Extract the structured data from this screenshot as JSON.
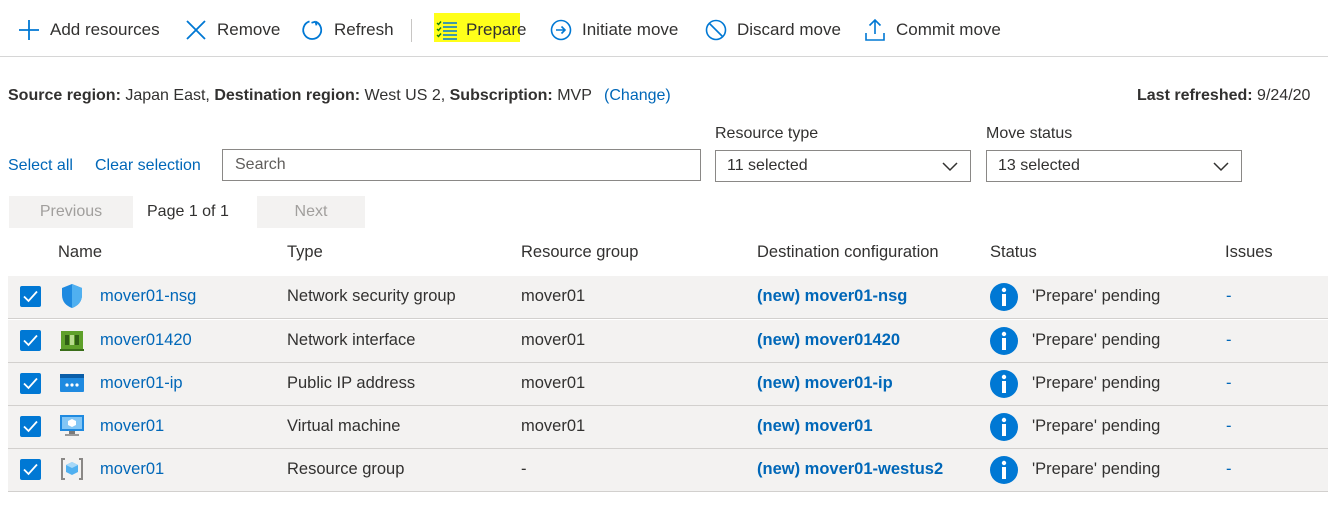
{
  "toolbar": {
    "add_resources": "Add resources",
    "remove": "Remove",
    "refresh": "Refresh",
    "prepare": "Prepare",
    "initiate_move": "Initiate move",
    "discard_move": "Discard move",
    "commit_move": "Commit move"
  },
  "summary": {
    "source_region_label": "Source region:",
    "source_region": "Japan East,",
    "destination_region_label": "Destination region:",
    "destination_region": "West US 2,",
    "subscription_label": "Subscription:",
    "subscription": "MVP",
    "change_link": "(Change)",
    "last_refreshed_label": "Last refreshed:",
    "last_refreshed": "9/24/20"
  },
  "filters": {
    "select_all": "Select all",
    "clear_selection": "Clear selection",
    "search_placeholder": "Search",
    "resource_type_label": "Resource type",
    "resource_type_value": "11 selected",
    "move_status_label": "Move status",
    "move_status_value": "13 selected"
  },
  "pager": {
    "previous": "Previous",
    "page_text": "Page 1 of 1",
    "next": "Next"
  },
  "table": {
    "headers": {
      "name": "Name",
      "type": "Type",
      "resource_group": "Resource group",
      "destination_configuration": "Destination configuration",
      "status": "Status",
      "issues": "Issues"
    },
    "rows": [
      {
        "name": "mover01-nsg",
        "icon": "network-security-group-icon",
        "type": "Network security group",
        "resource_group": "mover01",
        "destination": "(new) mover01-nsg",
        "status": "'Prepare' pending",
        "issues": "-"
      },
      {
        "name": "mover01420",
        "icon": "network-interface-icon",
        "type": "Network interface",
        "resource_group": "mover01",
        "destination": "(new) mover01420",
        "status": "'Prepare' pending",
        "issues": "-"
      },
      {
        "name": "mover01-ip",
        "icon": "public-ip-address-icon",
        "type": "Public IP address",
        "resource_group": "mover01",
        "destination": "(new) mover01-ip",
        "status": "'Prepare' pending",
        "issues": "-"
      },
      {
        "name": "mover01",
        "icon": "virtual-machine-icon",
        "type": "Virtual machine",
        "resource_group": "mover01",
        "destination": "(new) mover01",
        "status": "'Prepare' pending",
        "issues": "-"
      },
      {
        "name": "mover01",
        "icon": "resource-group-icon",
        "type": "Resource group",
        "resource_group": "-",
        "destination": "(new) mover01-westus2",
        "status": "'Prepare' pending",
        "issues": "-"
      }
    ]
  },
  "colors": {
    "accent": "#0078d4",
    "link": "#0067b8",
    "highlight": "#ffff1a",
    "row_background": "#f3f2f1"
  }
}
